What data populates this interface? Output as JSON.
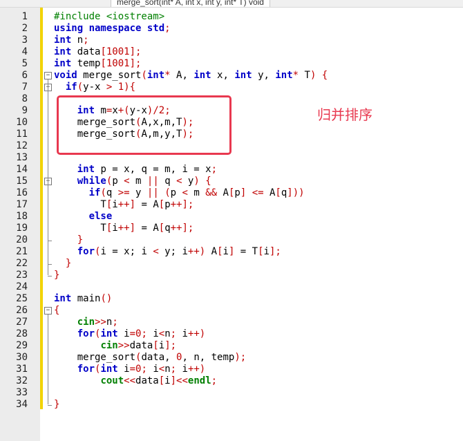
{
  "tab": {
    "title": "merge_sort(int* A, int x, int y, int* T) void"
  },
  "annotation": {
    "label": "归并排序"
  },
  "line_numbers": [
    "1",
    "2",
    "3",
    "4",
    "5",
    "6",
    "7",
    "8",
    "9",
    "10",
    "11",
    "12",
    "13",
    "14",
    "15",
    "16",
    "17",
    "18",
    "19",
    "20",
    "21",
    "22",
    "23",
    "24",
    "25",
    "26",
    "27",
    "28",
    "29",
    "30",
    "31",
    "32",
    "33",
    "34"
  ],
  "code_lines": [
    [
      [
        "pp",
        "#include <iostream>"
      ]
    ],
    [
      [
        "kw",
        "using namespace"
      ],
      [
        "id",
        " "
      ],
      [
        "kw",
        "std"
      ],
      [
        "op",
        ";"
      ]
    ],
    [
      [
        "kw",
        "int"
      ],
      [
        "id",
        " n"
      ],
      [
        "op",
        ";"
      ]
    ],
    [
      [
        "kw",
        "int"
      ],
      [
        "id",
        " data"
      ],
      [
        "op",
        "[1001];"
      ]
    ],
    [
      [
        "kw",
        "int"
      ],
      [
        "id",
        " temp"
      ],
      [
        "op",
        "[1001];"
      ]
    ],
    [
      [
        "kw",
        "void"
      ],
      [
        "id",
        " merge_sort"
      ],
      [
        "op",
        "("
      ],
      [
        "kw",
        "int"
      ],
      [
        "op",
        "*"
      ],
      [
        "id",
        " A, "
      ],
      [
        "kw",
        "int"
      ],
      [
        "id",
        " x, "
      ],
      [
        "kw",
        "int"
      ],
      [
        "id",
        " y, "
      ],
      [
        "kw",
        "int"
      ],
      [
        "op",
        "*"
      ],
      [
        "id",
        " T"
      ],
      [
        "op",
        ") {"
      ]
    ],
    [
      [
        "id",
        "  "
      ],
      [
        "kw",
        "if"
      ],
      [
        "op",
        "("
      ],
      [
        "id",
        "y-x "
      ],
      [
        "op",
        "> 1){"
      ]
    ],
    [],
    [
      [
        "id",
        "    "
      ],
      [
        "kw",
        "int"
      ],
      [
        "id",
        " m"
      ],
      [
        "op",
        "="
      ],
      [
        "id",
        "x"
      ],
      [
        "op",
        "+("
      ],
      [
        "id",
        "y-x"
      ],
      [
        "op",
        ")/2;"
      ]
    ],
    [
      [
        "id",
        "    merge_sort"
      ],
      [
        "op",
        "("
      ],
      [
        "id",
        "A,x,m,T"
      ],
      [
        "op",
        ");"
      ]
    ],
    [
      [
        "id",
        "    merge_sort"
      ],
      [
        "op",
        "("
      ],
      [
        "id",
        "A,m,y,T"
      ],
      [
        "op",
        ");"
      ]
    ],
    [],
    [],
    [
      [
        "id",
        "    "
      ],
      [
        "kw",
        "int"
      ],
      [
        "id",
        " p = x, q = m, i = x"
      ],
      [
        "op",
        ";"
      ]
    ],
    [
      [
        "id",
        "    "
      ],
      [
        "kw",
        "while"
      ],
      [
        "op",
        "("
      ],
      [
        "id",
        "p "
      ],
      [
        "op",
        "<"
      ],
      [
        "id",
        " m "
      ],
      [
        "op",
        "||"
      ],
      [
        "id",
        " q "
      ],
      [
        "op",
        "<"
      ],
      [
        "id",
        " y"
      ],
      [
        "op",
        ") {"
      ]
    ],
    [
      [
        "id",
        "      "
      ],
      [
        "kw",
        "if"
      ],
      [
        "op",
        "("
      ],
      [
        "id",
        "q "
      ],
      [
        "op",
        ">="
      ],
      [
        "id",
        " y "
      ],
      [
        "op",
        "||"
      ],
      [
        "id",
        " "
      ],
      [
        "op",
        "("
      ],
      [
        "id",
        "p "
      ],
      [
        "op",
        "<"
      ],
      [
        "id",
        " m "
      ],
      [
        "op",
        "&&"
      ],
      [
        "id",
        " A"
      ],
      [
        "op",
        "["
      ],
      [
        "id",
        "p"
      ],
      [
        "op",
        "]"
      ],
      [
        "id",
        " "
      ],
      [
        "op",
        "<="
      ],
      [
        "id",
        " A"
      ],
      [
        "op",
        "["
      ],
      [
        "id",
        "q"
      ],
      [
        "op",
        "]))"
      ]
    ],
    [
      [
        "id",
        "        T"
      ],
      [
        "op",
        "["
      ],
      [
        "id",
        "i"
      ],
      [
        "op",
        "++]"
      ],
      [
        "id",
        " = A"
      ],
      [
        "op",
        "["
      ],
      [
        "id",
        "p"
      ],
      [
        "op",
        "++];"
      ]
    ],
    [
      [
        "id",
        "      "
      ],
      [
        "kw",
        "else"
      ]
    ],
    [
      [
        "id",
        "        T"
      ],
      [
        "op",
        "["
      ],
      [
        "id",
        "i"
      ],
      [
        "op",
        "++]"
      ],
      [
        "id",
        " = A"
      ],
      [
        "op",
        "["
      ],
      [
        "id",
        "q"
      ],
      [
        "op",
        "++];"
      ]
    ],
    [
      [
        "op",
        "    }"
      ]
    ],
    [
      [
        "id",
        "    "
      ],
      [
        "kw",
        "for"
      ],
      [
        "op",
        "("
      ],
      [
        "id",
        "i = x; i "
      ],
      [
        "op",
        "<"
      ],
      [
        "id",
        " y; i"
      ],
      [
        "op",
        "++)"
      ],
      [
        "id",
        " A"
      ],
      [
        "op",
        "["
      ],
      [
        "id",
        "i"
      ],
      [
        "op",
        "]"
      ],
      [
        "id",
        " = T"
      ],
      [
        "op",
        "["
      ],
      [
        "id",
        "i"
      ],
      [
        "op",
        "];"
      ]
    ],
    [
      [
        "op",
        "  }"
      ]
    ],
    [
      [
        "op",
        "}"
      ]
    ],
    [],
    [
      [
        "kw",
        "int"
      ],
      [
        "id",
        " main"
      ],
      [
        "op",
        "()"
      ]
    ],
    [
      [
        "op",
        "{"
      ]
    ],
    [
      [
        "id",
        "    "
      ],
      [
        "gk",
        "cin"
      ],
      [
        "op",
        ">>"
      ],
      [
        "id",
        "n"
      ],
      [
        "op",
        ";"
      ]
    ],
    [
      [
        "id",
        "    "
      ],
      [
        "kw",
        "for"
      ],
      [
        "op",
        "("
      ],
      [
        "kw",
        "int"
      ],
      [
        "id",
        " i"
      ],
      [
        "op",
        "=0;"
      ],
      [
        "id",
        " i"
      ],
      [
        "op",
        "<"
      ],
      [
        "id",
        "n"
      ],
      [
        "op",
        ";"
      ],
      [
        "id",
        " i"
      ],
      [
        "op",
        "++)"
      ]
    ],
    [
      [
        "id",
        "        "
      ],
      [
        "gk",
        "cin"
      ],
      [
        "op",
        ">>"
      ],
      [
        "id",
        "data"
      ],
      [
        "op",
        "["
      ],
      [
        "id",
        "i"
      ],
      [
        "op",
        "];"
      ]
    ],
    [
      [
        "id",
        "    merge_sort"
      ],
      [
        "op",
        "("
      ],
      [
        "id",
        "data, "
      ],
      [
        "op",
        "0"
      ],
      [
        "id",
        ", n, temp"
      ],
      [
        "op",
        ");"
      ]
    ],
    [
      [
        "id",
        "    "
      ],
      [
        "kw",
        "for"
      ],
      [
        "op",
        "("
      ],
      [
        "kw",
        "int"
      ],
      [
        "id",
        " i"
      ],
      [
        "op",
        "=0;"
      ],
      [
        "id",
        " i"
      ],
      [
        "op",
        "<"
      ],
      [
        "id",
        "n"
      ],
      [
        "op",
        ";"
      ],
      [
        "id",
        " i"
      ],
      [
        "op",
        "++)"
      ]
    ],
    [
      [
        "id",
        "        "
      ],
      [
        "gk",
        "cout"
      ],
      [
        "op",
        "<<"
      ],
      [
        "id",
        "data"
      ],
      [
        "op",
        "["
      ],
      [
        "id",
        "i"
      ],
      [
        "op",
        "]<<"
      ],
      [
        "gk",
        "endl"
      ],
      [
        "op",
        ";"
      ]
    ],
    [],
    [
      [
        "op",
        "}"
      ]
    ]
  ]
}
